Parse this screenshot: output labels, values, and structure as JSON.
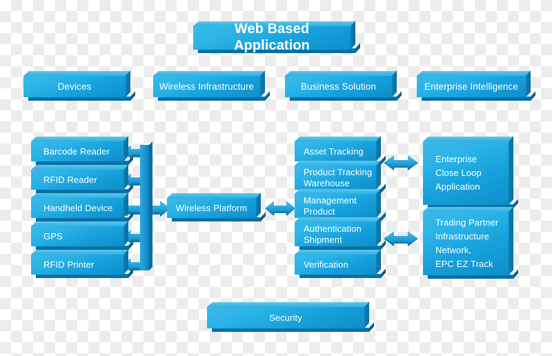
{
  "diagram": {
    "title": "Web Based Application",
    "categories": [
      {
        "label": "Devices"
      },
      {
        "label": "Wireless Infrastructure"
      },
      {
        "label": "Business Solution"
      },
      {
        "label": "Enterprise Intelligence"
      }
    ],
    "devices_column": [
      {
        "label": "Barcode Reader"
      },
      {
        "label": "RFID Reader"
      },
      {
        "label": "Handheld Device"
      },
      {
        "label": "GPS"
      },
      {
        "label": "RFID Printer"
      }
    ],
    "platform": {
      "label": "Wireless Platform"
    },
    "solutions_column": [
      {
        "label": "Asset Tracking"
      },
      {
        "label": "Product Tracking\nWarehouse"
      },
      {
        "label": "Management\nProduct"
      },
      {
        "label": "Authentication\nShipment"
      },
      {
        "label": "Verification"
      }
    ],
    "enterprise_column": [
      {
        "label": "Enterprise\nClose Loop\nApplication"
      },
      {
        "label": "Trading Partner\nInfrastructure\nNetwork,\nEPC EZ Track"
      }
    ],
    "footer": {
      "label": "Security"
    },
    "connectors": [
      {
        "name": "devices-bus-to-barcode-reader",
        "direction": "left"
      },
      {
        "name": "devices-bus-to-rfid-reader",
        "direction": "left"
      },
      {
        "name": "devices-bus-to-handheld-device",
        "direction": "left"
      },
      {
        "name": "devices-bus-to-gps",
        "direction": "left"
      },
      {
        "name": "devices-bus-to-rfid-printer",
        "direction": "left"
      },
      {
        "name": "devices-bus-to-wireless-platform",
        "direction": "right"
      },
      {
        "name": "wireless-platform-to-solutions",
        "direction": "both"
      },
      {
        "name": "solutions-to-enterprise-close-loop",
        "direction": "both"
      },
      {
        "name": "solutions-to-trading-partner",
        "direction": "both"
      }
    ],
    "colors": {
      "block_light": "#3cb9e8",
      "block_mid": "#16a0db",
      "block_dark": "#0e8ec9",
      "shelf": "#0a6ea2",
      "arrow_light": "#2eaae0",
      "arrow_dark": "#0d79b0",
      "text": "#ffffff",
      "background": "#ffffff",
      "checker": "#ececec"
    }
  }
}
